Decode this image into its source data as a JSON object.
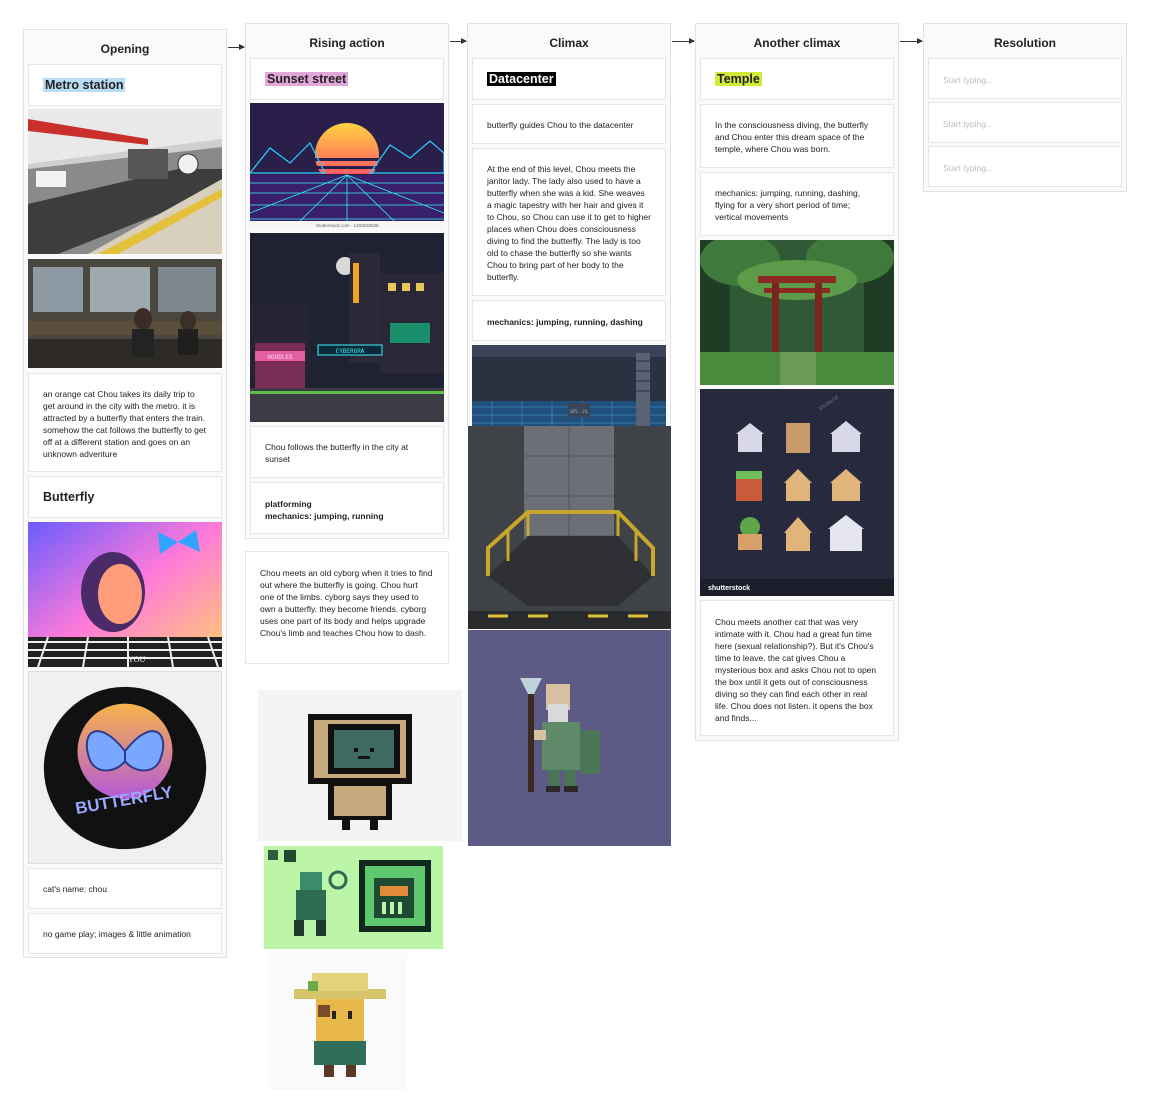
{
  "columns": [
    {
      "title": "Opening"
    },
    {
      "title": "Rising action"
    },
    {
      "title": "Climax"
    },
    {
      "title": "Another climax"
    },
    {
      "title": "Resolution"
    }
  ],
  "opening": {
    "heading": "Metro station",
    "description": "an orange cat Chou takes its daily trip to get around in the city with the metro. it is attracted by a butterfly that enters the train. somehow the cat follows the butterfly to get off at a different station and goes on an unknown adventure",
    "butterfly_heading": "Butterfly",
    "butterfly_badge_text": "BUTTERFLY",
    "poster_caption": "YOU",
    "cat_name": "cat's name: chou",
    "note": "no game play; images & little animation"
  },
  "rising": {
    "heading": "Sunset street",
    "image_credit": "shutterstock.com · 1493538638",
    "shop_sign_1": "NOODLES",
    "shop_sign_2": "CYBERGRA",
    "description": "Chou follows the butterfly in the city at sunset",
    "mechanics_line1": "platforming",
    "mechanics_line2": "mechanics: jumping, running",
    "cyborg_text": "Chou meets an old cyborg when it tries to find out where the butterfly is going. Chou hurt one of the limbs. cyborg says they used to own a butterfly. they become friends. cyborg uses one part of its body and helps upgrade Chou's limb and teaches Chou how to dash."
  },
  "climax": {
    "heading": "Datacenter",
    "guide_text": "butterfly guides Chou to the datacenter",
    "janitor_text": "At the end of this level, Chou meets the janitor lady. The lady also used to have a butterfly when she was a kid. She weaves a magic tapestry with her hair and gives it to Chou, so Chou can use it to get to higher places when Chou does consciousness diving to find the butterfly. The lady is too old to chase the butterfly so she wants Chou to bring part of her body to the butterfly.",
    "mechanics": "mechanics: jumping, running, dashing",
    "tile_label": "SPL 21"
  },
  "another": {
    "heading": "Temple",
    "diving_text": "In the consciousness diving, the butterfly and Chou enter this dream space of the temple, where Chou was born.",
    "mechanics_text": "mechanics: jumping, running, dashing, flying for a very short period of time; vertical movements",
    "watermark": "shutterstock",
    "watermark_short": "shutterst",
    "cat_text": "Chou meets another cat that was very intimate with it. Chou had a great fun time here (sexual relationship?). But it's Chou's time to leave. the cat gives Chou a mysterious box and asks Chou not to open the box until it gets out of consciousness diving so they can find each other in real life. Chou does not listen. it opens the box and finds..."
  },
  "resolution": {
    "placeholders": [
      "Start typing...",
      "Start typing...",
      "Start typing..."
    ]
  },
  "colors": {
    "metro_highlight": "#b9dcf5",
    "sunset_highlight": "#e3a6d8",
    "datacenter_highlight": "#000000",
    "temple_highlight": "#d2ea38"
  }
}
